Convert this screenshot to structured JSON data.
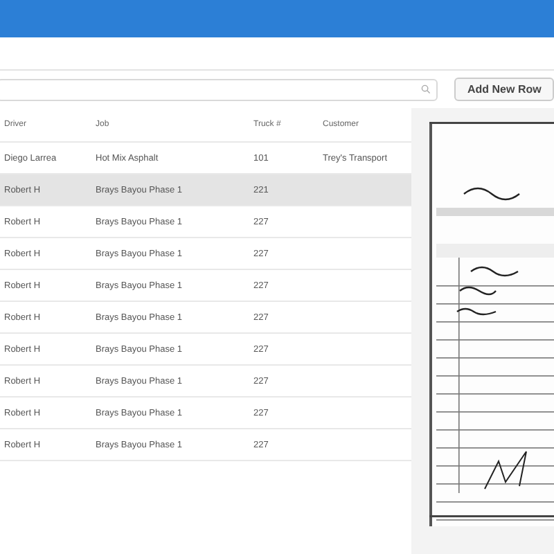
{
  "toolbar": {
    "add_button": "Add New Row"
  },
  "table": {
    "columns": [
      "Driver",
      "Job",
      "Truck #",
      "Customer"
    ],
    "rows": [
      {
        "cells": [
          "Diego Larrea",
          "Hot Mix Asphalt",
          "101",
          "Trey's Transport"
        ],
        "selected": false
      },
      {
        "cells": [
          "Robert H",
          "Brays Bayou Phase 1",
          "221"
        ],
        "selected": true
      },
      {
        "cells": [
          "Robert H",
          "Brays Bayou Phase 1",
          "227"
        ],
        "selected": false
      },
      {
        "cells": [
          "Robert H",
          "Brays Bayou Phase 1",
          "227"
        ],
        "selected": false
      },
      {
        "cells": [
          "Robert H",
          "Brays Bayou Phase 1",
          "227"
        ],
        "selected": false
      },
      {
        "cells": [
          "Robert H",
          "Brays Bayou Phase 1",
          "227"
        ],
        "selected": false
      },
      {
        "cells": [
          "Robert H",
          "Brays Bayou Phase 1",
          "227"
        ],
        "selected": false
      },
      {
        "cells": [
          "Robert H",
          "Brays Bayou Phase 1",
          "227"
        ],
        "selected": false
      },
      {
        "cells": [
          "Robert H",
          "Brays Bayou Phase 1",
          "227"
        ],
        "selected": false
      },
      {
        "cells": [
          "Robert H",
          "Brays Bayou Phase 1",
          "227"
        ],
        "selected": false
      }
    ]
  }
}
